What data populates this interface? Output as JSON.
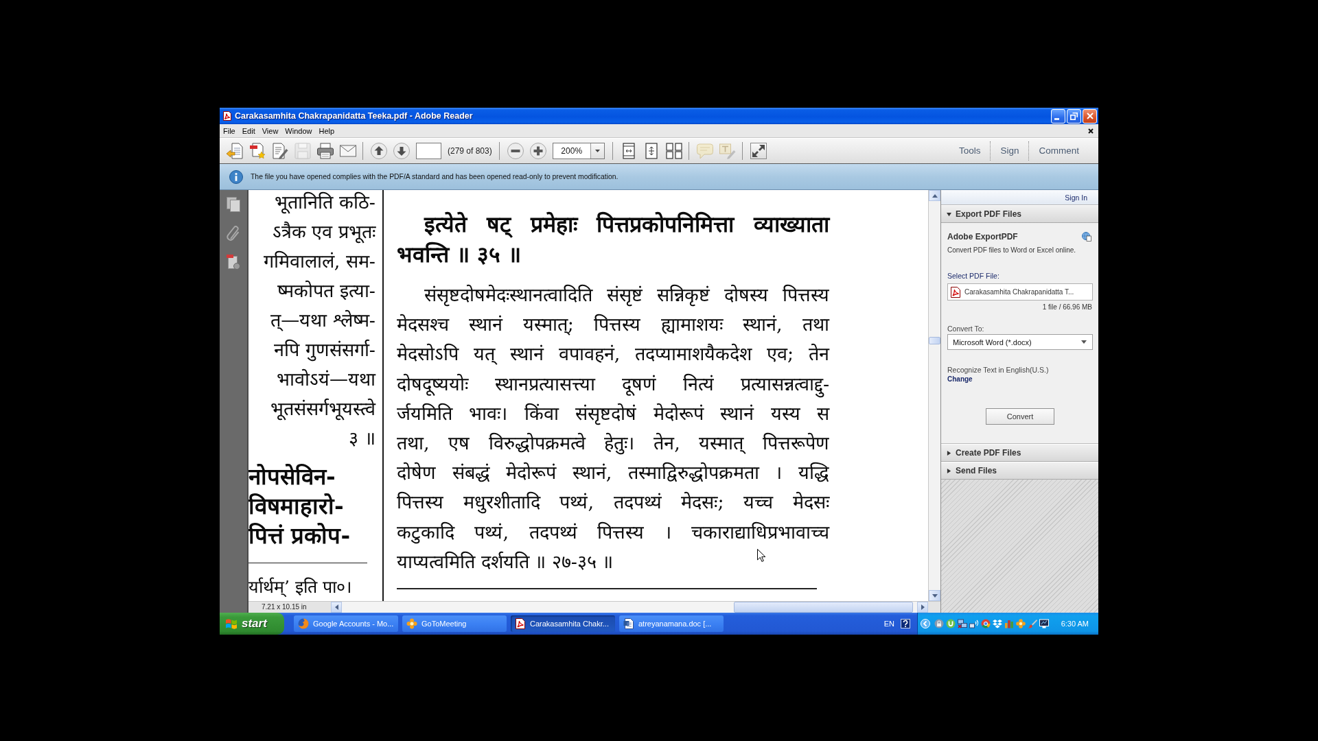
{
  "window": {
    "title": "Carakasamhita Chakrapanidatta Teeka.pdf - Adobe Reader"
  },
  "menu": [
    "File",
    "Edit",
    "View",
    "Window",
    "Help"
  ],
  "toolbar": {
    "file_buttons": [
      {
        "kind": "create",
        "disabled": false
      },
      {
        "kind": "combine",
        "disabled": false
      },
      {
        "kind": "edit",
        "disabled": false
      },
      {
        "kind": "save",
        "disabled": true
      },
      {
        "kind": "print",
        "disabled": false
      },
      {
        "kind": "email",
        "disabled": false
      }
    ],
    "nav_buttons": [
      {
        "kind": "up"
      },
      {
        "kind": "down"
      }
    ],
    "page_count": "(279 of 803)",
    "zoom_buttons": [
      {
        "kind": "minus"
      },
      {
        "kind": "plus"
      }
    ],
    "zoom_value": "200%",
    "view_buttons": [
      {
        "kind": "fit-width"
      },
      {
        "kind": "fit-height"
      },
      {
        "kind": "grid"
      }
    ],
    "annotate_buttons": [
      {
        "kind": "comment",
        "disabled": true
      },
      {
        "kind": "typewriter",
        "disabled": true
      }
    ],
    "mode_buttons": [
      {
        "kind": "fullscreen"
      }
    ],
    "panes": [
      "Tools",
      "Sign",
      "Comment"
    ]
  },
  "info_bar": {
    "message": "The file you have opened complies with the PDF/A standard and has been opened read-only to prevent modification."
  },
  "document": {
    "left_column": [
      {
        "kind": "plain",
        "text": "भूतानिति कठि-"
      },
      {
        "kind": "plain",
        "text": "ऽत्रैक एव प्रभूतः"
      },
      {
        "kind": "plain",
        "text": "गमिवालालं, सम-"
      },
      {
        "kind": "plain",
        "text": "ष्मकोपत इत्या-"
      },
      {
        "kind": "plain",
        "text": "त्—यथा श्लेष्म-"
      },
      {
        "kind": "plain",
        "text": "नपि गुणसंसर्गा-"
      },
      {
        "kind": "plain",
        "text": "भावोऽयं—यथा"
      },
      {
        "kind": "plain",
        "text": "भूतसंसर्गभूयस्त्वे"
      },
      {
        "kind": "plain",
        "text": "३ ॥"
      },
      {
        "kind": "bold",
        "text": "नोपसेविन-"
      },
      {
        "kind": "bold",
        "text": "विषमाहारो-"
      },
      {
        "kind": "bold",
        "text": "पित्तं प्रकोप-"
      },
      {
        "kind": "footnote",
        "text": "र्यार्थम्’ इति पा०।"
      }
    ],
    "verse": [
      "इत्येते षट् प्रमेहाः पित्तप्रकोपनिमित्ता व्याख्याता",
      "भवन्ति ॥ ३५ ॥"
    ],
    "commentary": [
      "संसृष्टदोषमेदःस्थानत्वादिति संसृष्टं सन्निकृष्टं दोषस्य पित्तस्य",
      "मेदसश्च स्थानं यस्मात्; पित्तस्य ह्यामाशयः स्थानं, तथा",
      "मेदसोऽपि यत् स्थानं वपावहनं, तदप्यामाशयैकदेश एव; तेन",
      "दोषदूष्ययोः स्थानप्रत्यासत्त्या दूषणं नित्यं प्रत्यासन्नत्वाद्दु-",
      "र्जयमिति भावः। किंवा संसृष्टदोषं मेदोरूपं स्थानं यस्य स",
      "तथा, एष विरुद्धोपक्रमत्वे हेतुः। तेन, यस्मात् पित्तरूपेण",
      "दोषेण संबद्धं मेदोरूपं स्थानं, तस्माद्विरुद्धोपक्रमता । यद्धि",
      "पित्तस्य मधुरशीतादि पथ्यं, तदपथ्यं मेदसः; यच्च मेदसः",
      "कटुकादि पथ्यं, तदपथ्यं पित्तस्य । चकाराद्याधिप्रभावाच्च",
      "याप्यत्वमिति दर्शयति ॥ २७-३५ ॥"
    ],
    "page_size": "7.21 x 10.15 in"
  },
  "right_panel": {
    "sign_in": "Sign In",
    "sections": [
      {
        "title": "Export PDF Files",
        "expanded": true,
        "content": {
          "heading": "Adobe ExportPDF",
          "description": "Convert PDF files to Word or Excel online.",
          "select_label": "Select PDF File:",
          "file_name": "Carakasamhita Chakrapanidatta T...",
          "file_info": "1 file / 66.96 MB",
          "convert_label": "Convert To:",
          "format": "Microsoft Word (*.docx)",
          "recognize": "Recognize Text in English(U.S.)",
          "change_link": "Change",
          "convert_button": "Convert"
        }
      },
      {
        "title": "Create PDF Files",
        "expanded": false
      },
      {
        "title": "Send Files",
        "expanded": false
      }
    ]
  },
  "taskbar": {
    "start": "start",
    "tasks": [
      {
        "label": "Google Accounts - Mo...",
        "kind": "browser",
        "selected": false
      },
      {
        "label": "GoToMeeting",
        "kind": "meeting",
        "selected": false
      },
      {
        "label": "Carakasamhita Chakr...",
        "kind": "pdf",
        "selected": true
      },
      {
        "label": "atreyanamana.doc [...",
        "kind": "word",
        "selected": false
      }
    ],
    "language": "EN",
    "clock": "6:30 AM"
  }
}
